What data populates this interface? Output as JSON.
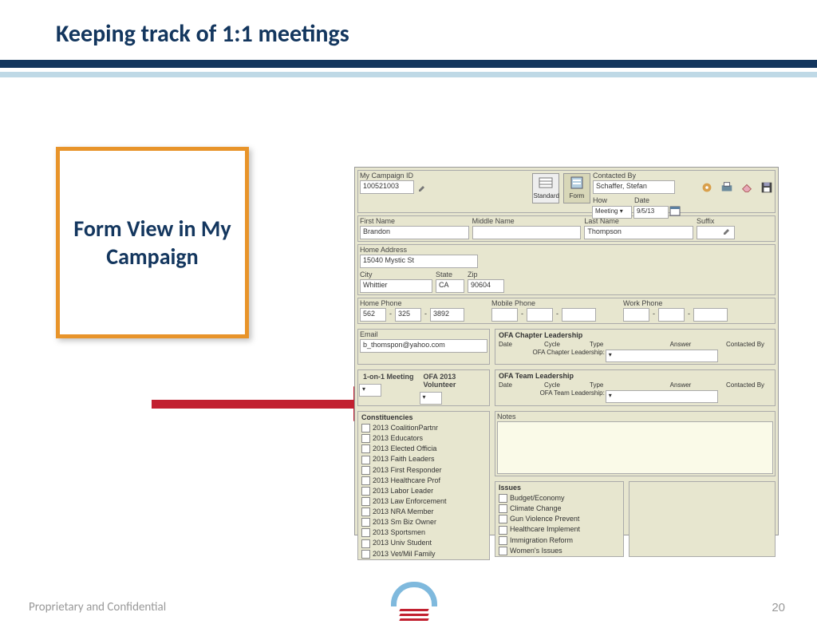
{
  "slide": {
    "title": "Keeping track of 1:1 meetings",
    "callout": "Form View in My Campaign",
    "footer": "Proprietary and Confidential",
    "page": "20"
  },
  "toolbar": {
    "standard": "Standard",
    "form": "Form"
  },
  "top": {
    "idLabel": "My Campaign ID",
    "id": "100521003",
    "contactedBy": "Contacted By",
    "contact": "Schaffer, Stefan",
    "how": "How",
    "howVal": "Meeting",
    "date": "Date",
    "dateVal": "9/5/13"
  },
  "person": {
    "fn": "First Name",
    "fnV": "Brandon",
    "mn": "Middle Name",
    "ln": "Last Name",
    "lnV": "Thompson",
    "sfx": "Suffix",
    "ha": "Home Address",
    "haV": "15040 Mystic St",
    "city": "City",
    "cityV": "Whittier",
    "st": "State",
    "stV": "CA",
    "zip": "Zip",
    "zipV": "90604",
    "hp": "Home Phone",
    "hpV1": "562",
    "hpV2": "325",
    "hpV3": "3892",
    "mp": "Mobile Phone",
    "wp": "Work Phone",
    "email": "Email",
    "emailV": "b_thomspon@yahoo.com"
  },
  "mtg": {
    "one": "1-on-1 Meeting",
    "vol": "OFA 2013 Volunteer"
  },
  "leader": {
    "ch": "OFA Chapter Leadership",
    "tm": "OFA Team Leadership",
    "date": "Date",
    "cycle": "Cycle",
    "type": "Type",
    "answer": "Answer",
    "cb": "Contacted By",
    "chRow": "OFA Chapter Leadership:",
    "tmRow": "OFA Team Leadership:"
  },
  "con": {
    "h": "Constituencies",
    "items": [
      "2013 CoalitionPartnr",
      "2013 Educators",
      "2013 Elected Officia",
      "2013 Faith Leaders",
      "2013 First Responder",
      "2013 Healthcare Prof",
      "2013 Labor Leader",
      "2013 Law Enforcement",
      "2013 NRA Member",
      "2013 Sm Biz Owner",
      "2013 Sportsmen",
      "2013 Univ Student",
      "2013 Vet/Mil Family"
    ]
  },
  "notes": "Notes",
  "issues": {
    "h": "Issues",
    "items": [
      "Budget/Economy",
      "Climate Change",
      "Gun Violence Prevent",
      "Healthcare Implement",
      "Immigration Reform",
      "Women's Issues"
    ]
  }
}
